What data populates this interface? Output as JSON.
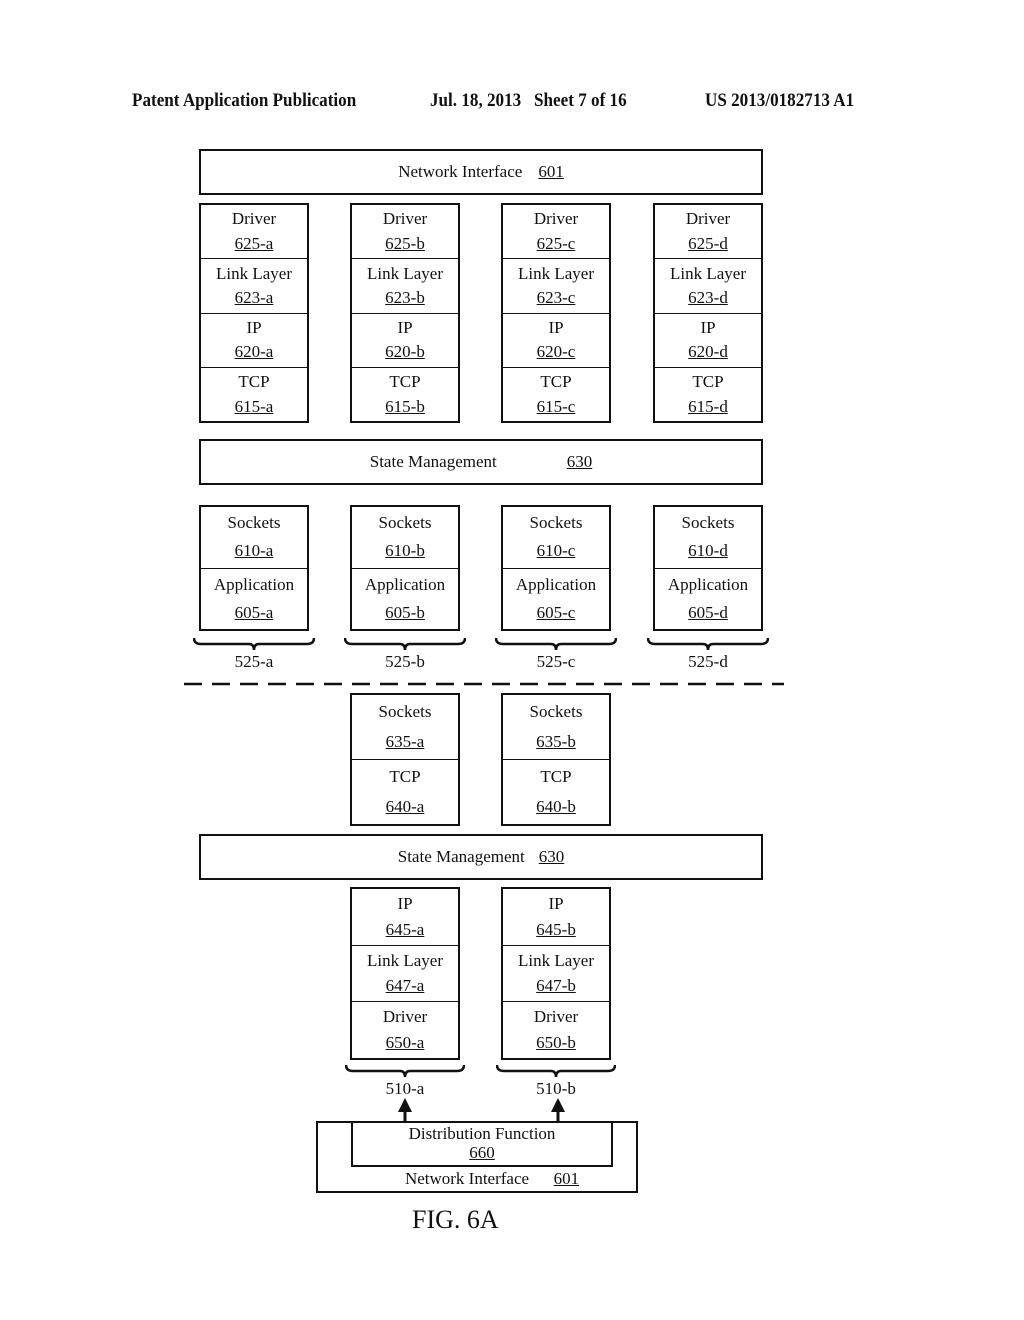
{
  "header": {
    "publication": "Patent Application Publication",
    "date_sheet": "Jul. 18, 2013   Sheet 7 of 16",
    "number": "US 2013/0182713 A1"
  },
  "top_network_interface": {
    "label": "Network Interface",
    "ref": "601"
  },
  "upper_stacks": [
    {
      "layers": [
        {
          "label": "Driver",
          "ref": "625-a"
        },
        {
          "label": "Link Layer",
          "ref": "623-a"
        },
        {
          "label": "IP",
          "ref": "620-a"
        },
        {
          "label": "TCP",
          "ref": "615-a"
        }
      ]
    },
    {
      "layers": [
        {
          "label": "Driver",
          "ref": "625-b"
        },
        {
          "label": "Link Layer",
          "ref": "623-b"
        },
        {
          "label": "IP",
          "ref": "620-b"
        },
        {
          "label": "TCP",
          "ref": "615-b"
        }
      ]
    },
    {
      "layers": [
        {
          "label": "Driver",
          "ref": "625-c"
        },
        {
          "label": "Link Layer",
          "ref": "623-c"
        },
        {
          "label": "IP",
          "ref": "620-c"
        },
        {
          "label": "TCP",
          "ref": "615-c"
        }
      ]
    },
    {
      "layers": [
        {
          "label": "Driver",
          "ref": "625-d"
        },
        {
          "label": "Link Layer",
          "ref": "623-d"
        },
        {
          "label": "IP",
          "ref": "620-d"
        },
        {
          "label": "TCP",
          "ref": "615-d"
        }
      ]
    }
  ],
  "state_management_1": {
    "label": "State Management",
    "ref": "630"
  },
  "app_stacks": [
    {
      "layers": [
        {
          "label": "Sockets",
          "ref": "610-a"
        },
        {
          "label": "Application",
          "ref": "605-a"
        }
      ],
      "group": "525-a"
    },
    {
      "layers": [
        {
          "label": "Sockets",
          "ref": "610-b"
        },
        {
          "label": "Application",
          "ref": "605-b"
        }
      ],
      "group": "525-b"
    },
    {
      "layers": [
        {
          "label": "Sockets",
          "ref": "610-c"
        },
        {
          "label": "Application",
          "ref": "605-c"
        }
      ],
      "group": "525-c"
    },
    {
      "layers": [
        {
          "label": "Sockets",
          "ref": "610-d"
        },
        {
          "label": "Application",
          "ref": "605-d"
        }
      ],
      "group": "525-d"
    }
  ],
  "lower_socket_stacks": [
    {
      "layers": [
        {
          "label": "Sockets",
          "ref": "635-a"
        },
        {
          "label": "TCP",
          "ref": "640-a"
        }
      ]
    },
    {
      "layers": [
        {
          "label": "Sockets",
          "ref": "635-b"
        },
        {
          "label": "TCP",
          "ref": "640-b"
        }
      ]
    }
  ],
  "state_management_2": {
    "label": "State Management",
    "ref": "630"
  },
  "lower_net_stacks": [
    {
      "layers": [
        {
          "label": "IP",
          "ref": "645-a"
        },
        {
          "label": "Link Layer",
          "ref": "647-a"
        },
        {
          "label": "Driver",
          "ref": "650-a"
        }
      ],
      "group": "510-a"
    },
    {
      "layers": [
        {
          "label": "IP",
          "ref": "645-b"
        },
        {
          "label": "Link Layer",
          "ref": "647-b"
        },
        {
          "label": "Driver",
          "ref": "650-b"
        }
      ],
      "group": "510-b"
    }
  ],
  "distribution_function": {
    "label": "Distribution Function",
    "ref": "660"
  },
  "bottom_network_interface": {
    "label": "Network Interface",
    "ref": "601"
  },
  "figure_label": "FIG. 6A"
}
